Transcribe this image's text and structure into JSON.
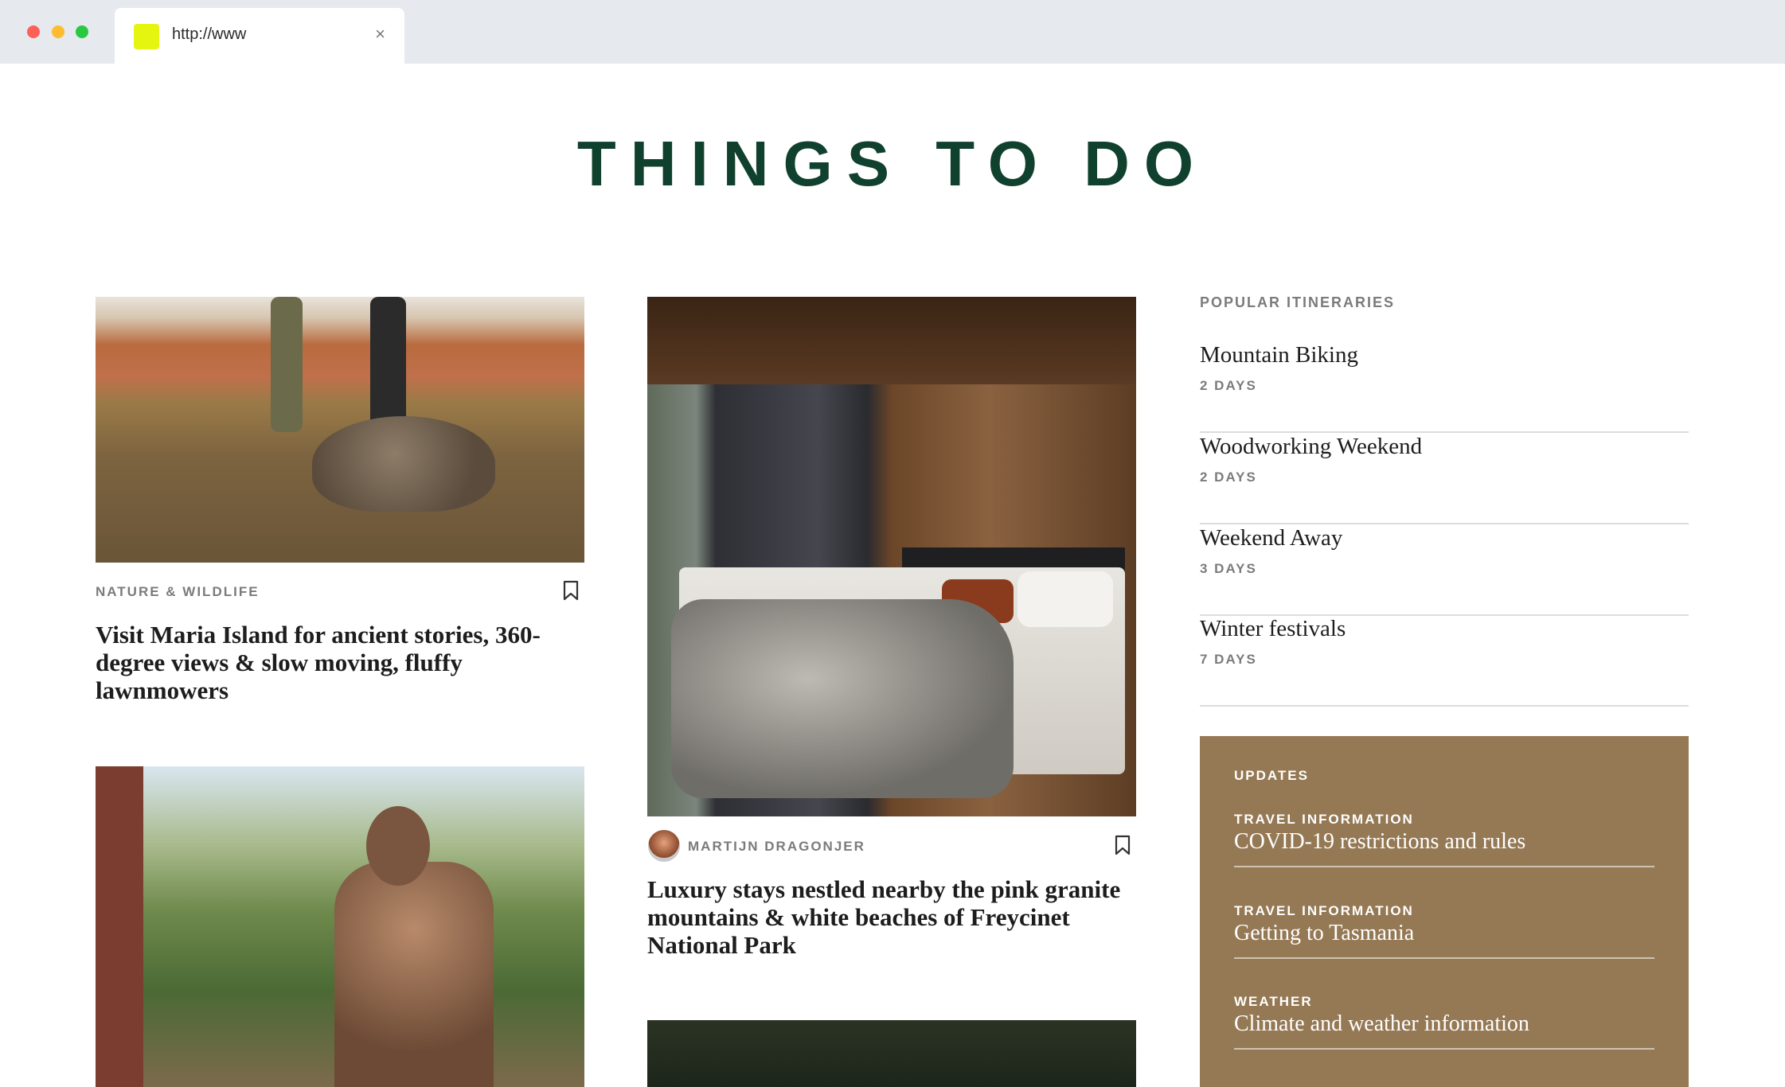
{
  "browser": {
    "tab_title": "http://www",
    "close_glyph": "×",
    "favicon_color": "#e6f50f"
  },
  "page": {
    "title": "THINGS TO DO",
    "title_color": "#10402e"
  },
  "cards": {
    "maria": {
      "category": "NATURE & WILDLIFE",
      "title": "Visit Maria Island for ancient stories, 360-degree views & slow moving, fluffy lawnmowers"
    },
    "freycinet": {
      "author": "MARTIJN DRAGONJER",
      "title": "Luxury stays nestled nearby the pink granite mountains & white beaches of Freycinet National Park"
    }
  },
  "sidebar": {
    "heading": "POPULAR ITINERARIES",
    "itineraries": [
      {
        "title": "Mountain Biking",
        "days": "2 DAYS"
      },
      {
        "title": "Woodworking Weekend",
        "days": "2 DAYS"
      },
      {
        "title": "Weekend Away",
        "days": "3 DAYS"
      },
      {
        "title": "Winter festivals",
        "days": "7 DAYS"
      }
    ]
  },
  "updates": {
    "heading": "UPDATES",
    "background_color": "#957955",
    "items": [
      {
        "category": "TRAVEL INFORMATION",
        "title": "COVID-19 restrictions and rules"
      },
      {
        "category": "TRAVEL INFORMATION",
        "title": "Getting to Tasmania"
      },
      {
        "category": "WEATHER",
        "title": "Climate and weather information"
      }
    ]
  }
}
